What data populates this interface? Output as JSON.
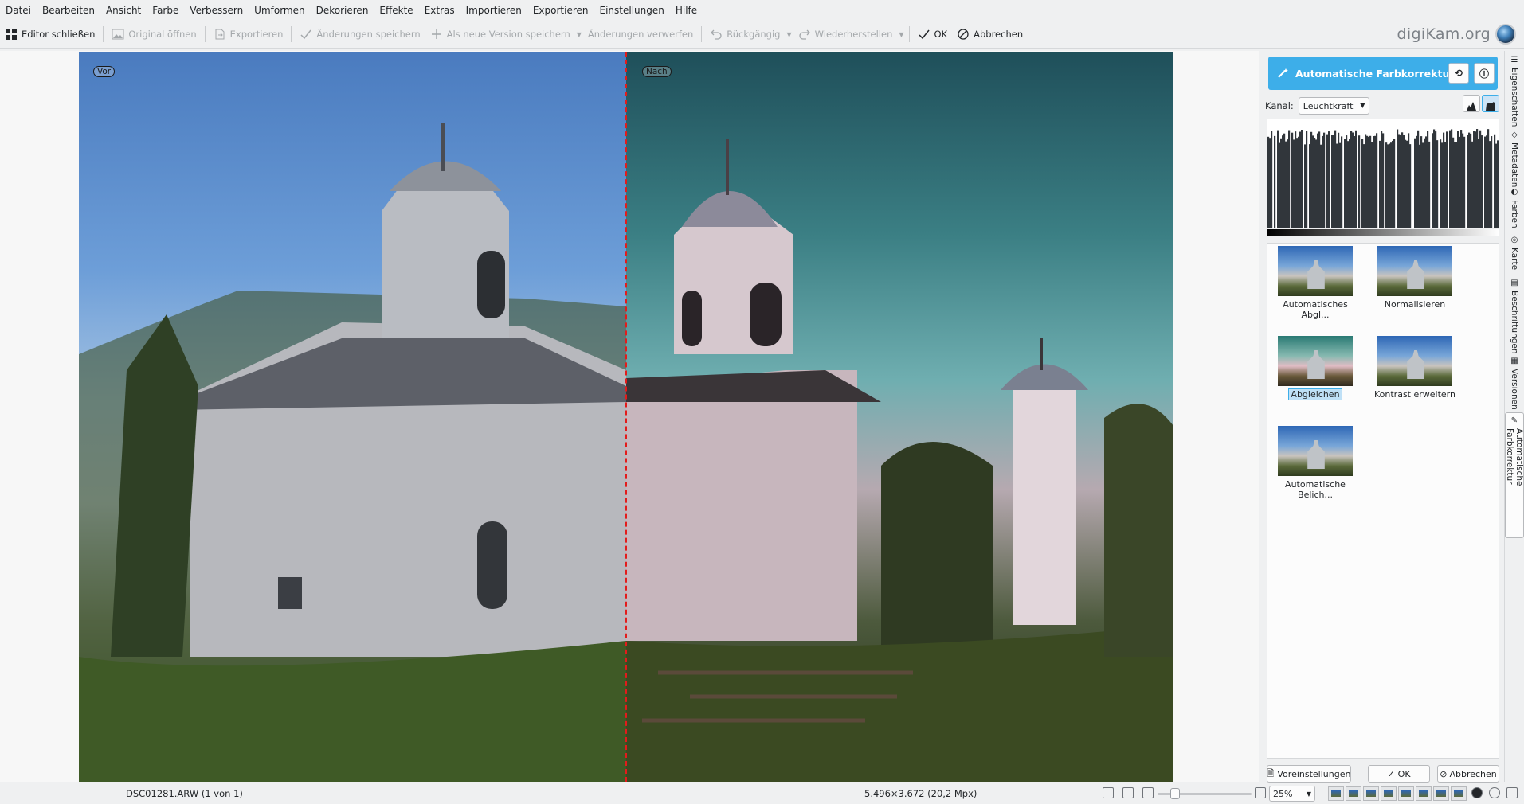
{
  "menu": [
    "Datei",
    "Bearbeiten",
    "Ansicht",
    "Farbe",
    "Verbessern",
    "Umformen",
    "Dekorieren",
    "Effekte",
    "Extras",
    "Importieren",
    "Exportieren",
    "Einstellungen",
    "Hilfe"
  ],
  "toolbar": {
    "close_editor": "Editor schließen",
    "open_original": "Original öffnen",
    "export": "Exportieren",
    "save_changes": "Änderungen speichern",
    "save_new_version": "Als neue Version speichern",
    "discard_changes": "Änderungen verwerfen",
    "undo": "Rückgängig",
    "redo": "Wiederherstellen",
    "ok": "OK",
    "cancel": "Abbrechen"
  },
  "brand": "digiKam.org",
  "canvas": {
    "before_label": "Vor",
    "after_label": "Nach",
    "divider_color": "#e31b1b"
  },
  "tool": {
    "title": "Automatische Farbkorrektur",
    "header_color": "#3daee9",
    "channel_label": "Kanal:",
    "channel_value": "Leuchtkraft",
    "presets": [
      {
        "label": "Automatisches Abgl...",
        "selected": false
      },
      {
        "label": "Normalisieren",
        "selected": false
      },
      {
        "label": "Abgleichen",
        "selected": true
      },
      {
        "label": "Kontrast erweitern",
        "selected": false
      },
      {
        "label": "Automatische Belich...",
        "selected": false
      }
    ],
    "footer": {
      "presets": "Voreinstellungen",
      "ok": "OK",
      "cancel": "Abbrechen"
    }
  },
  "side_tabs": [
    "Eigenschaften",
    "Metadaten",
    "Farben",
    "Karte",
    "Beschriftungen",
    "Versionen",
    "Automatische Farbkorrektur"
  ],
  "status": {
    "file": "DSC01281.ARW (1 von 1)",
    "dimensions": "5.496×3.672 (20,2 Mpx)",
    "zoom": "25%"
  }
}
